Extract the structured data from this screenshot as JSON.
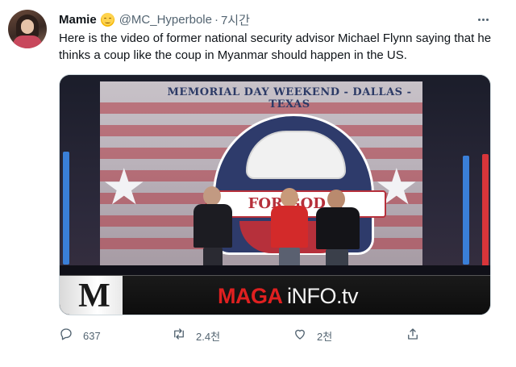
{
  "tweet": {
    "author_name": "Mamie",
    "author_emoji": "relieved-face-emoji",
    "handle": "@MC_Hyperbole",
    "separator": "·",
    "time": "7시간",
    "text": "Here is the video of former national security advisor Michael Flynn saying that he thinks a coup like the coup in Myanmar should happen in the US."
  },
  "media": {
    "type": "video-still",
    "banner_text": "MEMORIAL DAY WEEKEND - DALLAS - TEXAS",
    "logo_text": "FOR GOD & COUNTRY",
    "watermark_m": "M",
    "watermark_maga": "MAGA",
    "watermark_info": "iNFO.tv"
  },
  "actions": {
    "reply_count": "637",
    "retweet_count": "2.4천",
    "like_count": "2천",
    "reply_icon": "reply-icon",
    "retweet_icon": "retweet-icon",
    "like_icon": "heart-icon",
    "share_icon": "share-icon"
  },
  "colors": {
    "text_primary": "#0f1419",
    "text_secondary": "#536471",
    "border": "#cfd9de"
  }
}
